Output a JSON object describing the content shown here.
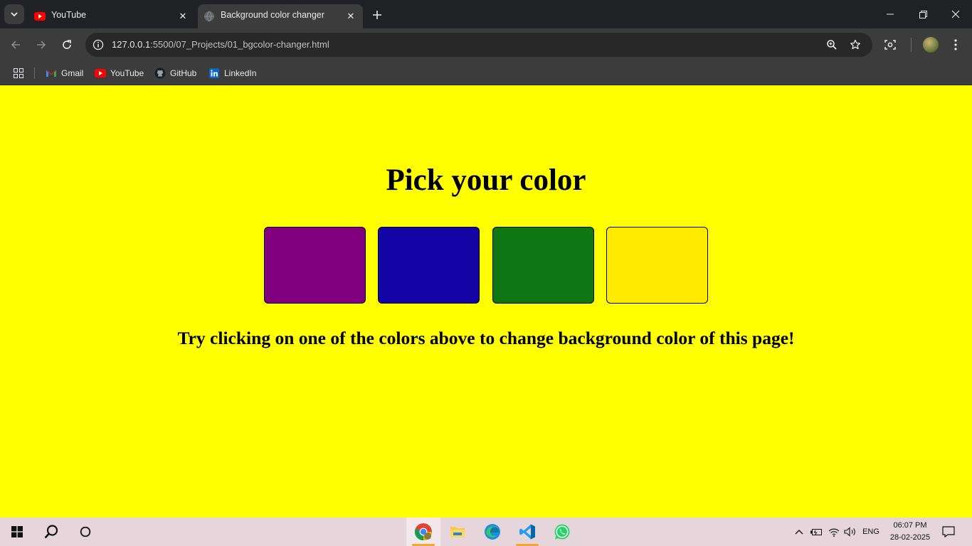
{
  "browser": {
    "tabs": [
      {
        "title": "YouTube",
        "active": false
      },
      {
        "title": "Background color changer",
        "active": true
      }
    ],
    "address": {
      "host": "127.0.0.1",
      "path": ":5500/07_Projects/01_bgcolor-changer.html"
    },
    "bookmarks": [
      {
        "label": "Gmail",
        "icon": "gmail-icon"
      },
      {
        "label": "YouTube",
        "icon": "youtube-icon"
      },
      {
        "label": "GitHub",
        "icon": "github-icon"
      },
      {
        "label": "LinkedIn",
        "icon": "linkedin-icon"
      }
    ]
  },
  "page": {
    "background": "#ffff00",
    "heading": "Pick your color",
    "swatches": [
      {
        "name": "purple",
        "color": "#800080"
      },
      {
        "name": "blue",
        "color": "#1405a6"
      },
      {
        "name": "green",
        "color": "#0e7612"
      },
      {
        "name": "yellow",
        "color": "#ffea00"
      }
    ],
    "instruction": "Try clicking on one of the colors above to change background color of this page!"
  },
  "taskbar": {
    "apps": [
      "chrome-icon",
      "file-explorer-icon",
      "edge-icon",
      "vscode-icon",
      "whatsapp-icon"
    ],
    "language": "ENG",
    "time": "06:07 PM",
    "date": "28-02-2025"
  }
}
